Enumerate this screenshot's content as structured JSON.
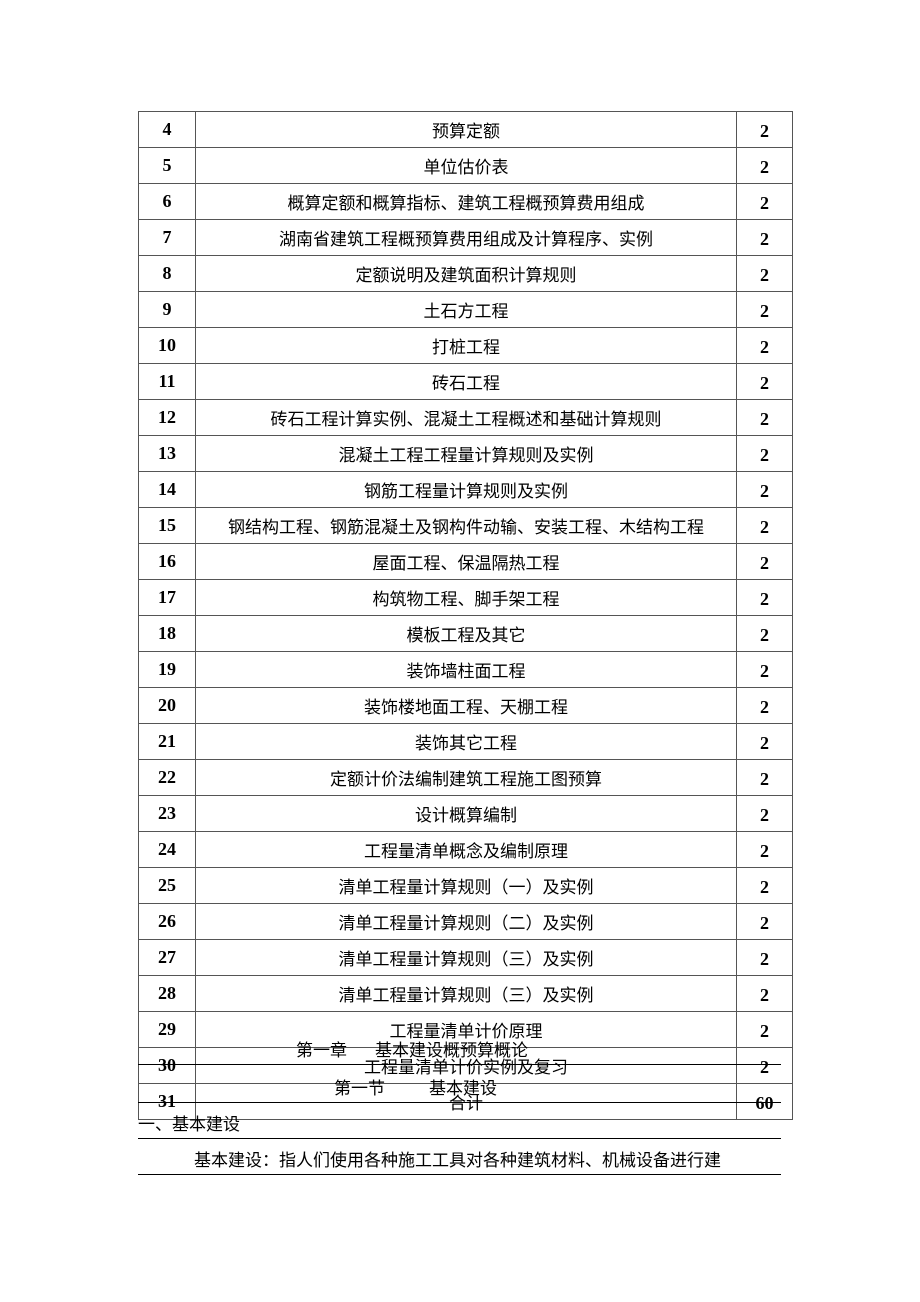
{
  "table": {
    "rows": [
      {
        "no": "4",
        "topic": "预算定额",
        "hours": "2"
      },
      {
        "no": "5",
        "topic": "单位估价表",
        "hours": "2"
      },
      {
        "no": "6",
        "topic": "概算定额和概算指标、建筑工程概预算费用组成",
        "hours": "2"
      },
      {
        "no": "7",
        "topic": "湖南省建筑工程概预算费用组成及计算程序、实例",
        "hours": "2"
      },
      {
        "no": "8",
        "topic": "定额说明及建筑面积计算规则",
        "hours": "2"
      },
      {
        "no": "9",
        "topic": "土石方工程",
        "hours": "2"
      },
      {
        "no": "10",
        "topic": "打桩工程",
        "hours": "2"
      },
      {
        "no": "11",
        "topic": "砖石工程",
        "hours": "2"
      },
      {
        "no": "12",
        "topic": "砖石工程计算实例、混凝土工程概述和基础计算规则",
        "hours": "2"
      },
      {
        "no": "13",
        "topic": "混凝土工程工程量计算规则及实例",
        "hours": "2"
      },
      {
        "no": "14",
        "topic": "钢筋工程量计算规则及实例",
        "hours": "2"
      },
      {
        "no": "15",
        "topic": "钢结构工程、钢筋混凝土及钢构件动输、安装工程、木结构工程",
        "hours": "2"
      },
      {
        "no": "16",
        "topic": "屋面工程、保温隔热工程",
        "hours": "2"
      },
      {
        "no": "17",
        "topic": "构筑物工程、脚手架工程",
        "hours": "2"
      },
      {
        "no": "18",
        "topic": "模板工程及其它",
        "hours": "2"
      },
      {
        "no": "19",
        "topic": "装饰墙柱面工程",
        "hours": "2"
      },
      {
        "no": "20",
        "topic": "装饰楼地面工程、天棚工程",
        "hours": "2"
      },
      {
        "no": "21",
        "topic": "装饰其它工程",
        "hours": "2"
      },
      {
        "no": "22",
        "topic": "定额计价法编制建筑工程施工图预算",
        "hours": "2"
      },
      {
        "no": "23",
        "topic": "设计概算编制",
        "hours": "2"
      },
      {
        "no": "24",
        "topic": "工程量清单概念及编制原理",
        "hours": "2"
      },
      {
        "no": "25",
        "topic": "清单工程量计算规则（一）及实例",
        "hours": "2"
      },
      {
        "no": "26",
        "topic": "清单工程量计算规则（二）及实例",
        "hours": "2"
      },
      {
        "no": "27",
        "topic": "清单工程量计算规则（三）及实例",
        "hours": "2"
      },
      {
        "no": "28",
        "topic": "清单工程量计算规则（三）及实例",
        "hours": "2"
      },
      {
        "no": "29",
        "topic": "工程量清单计价原理",
        "hours": "2"
      },
      {
        "no": "30",
        "topic": "工程量清单计价实例及复习",
        "hours": "2"
      },
      {
        "no": "31",
        "topic": "合计",
        "hours": "60"
      }
    ]
  },
  "chapter": {
    "label": "第一章",
    "title": "基本建设概预算概论"
  },
  "section": {
    "label": "第一节",
    "title": "基本建设"
  },
  "subheading": "一、基本建设",
  "paragraph": "基本建设：指人们使用各种施工工具对各种建筑材料、机械设备进行建"
}
